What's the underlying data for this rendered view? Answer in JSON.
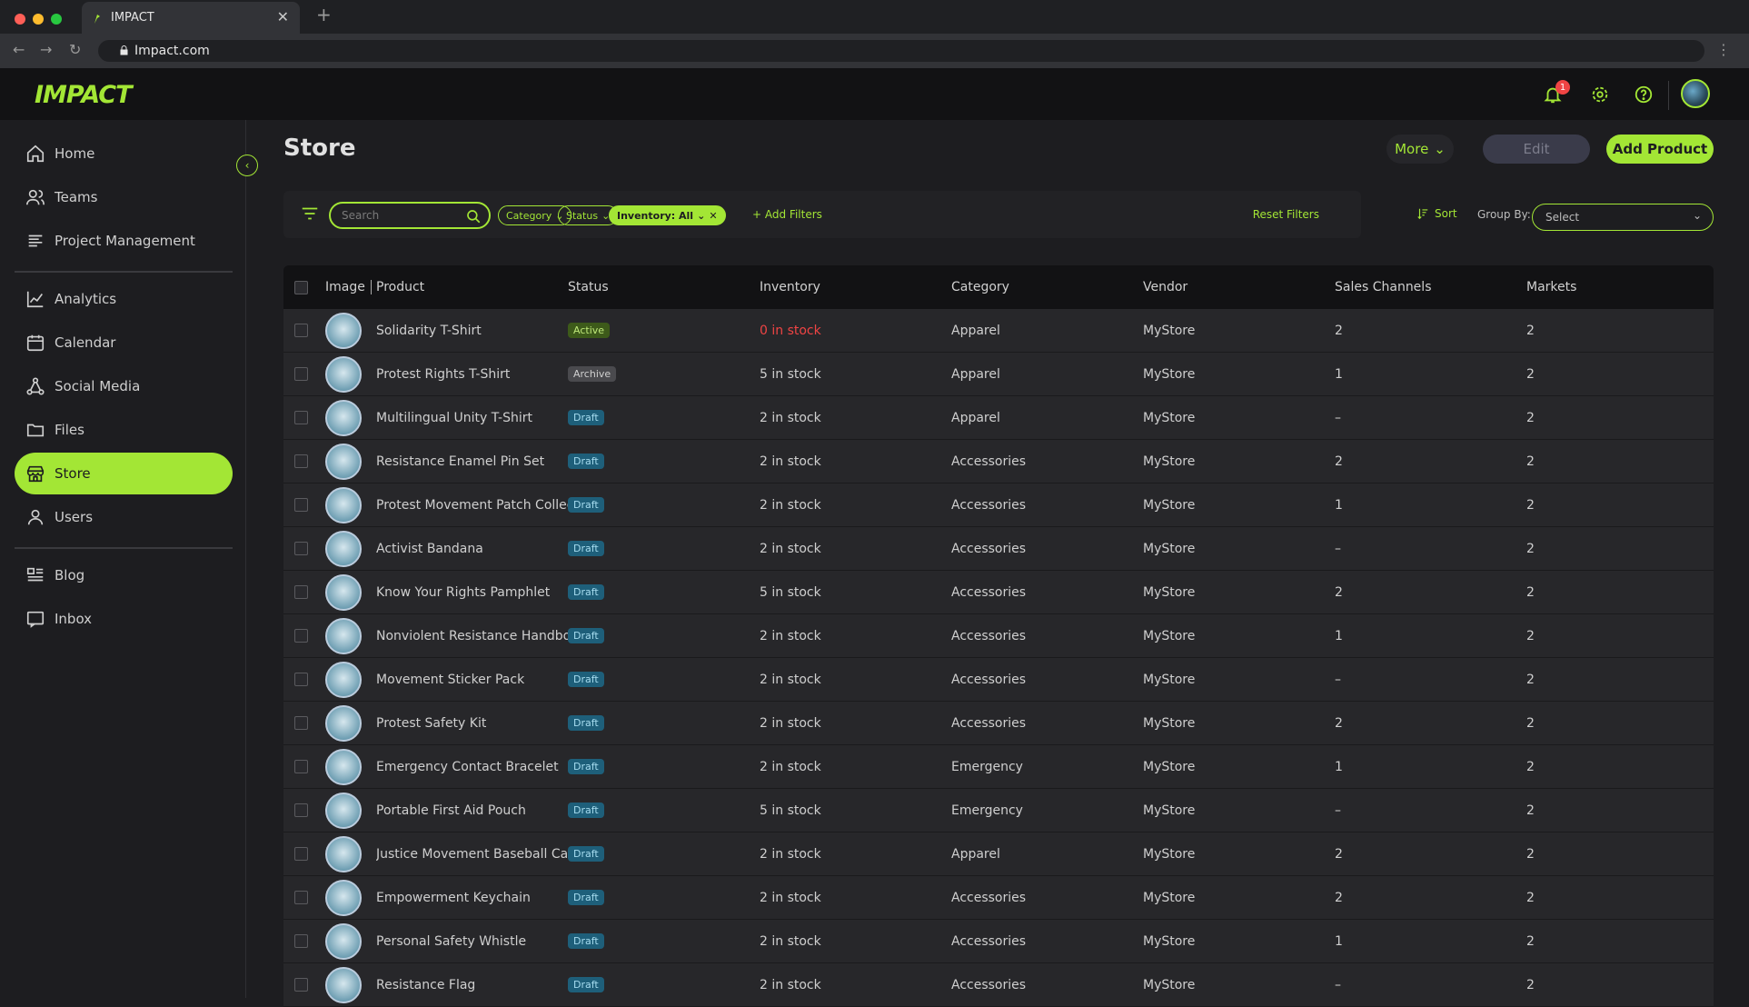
{
  "browser": {
    "tab_title": "IMPACT",
    "url": "Impact.com",
    "new_tab": "+",
    "close": "✕"
  },
  "header": {
    "logo": "IMPACT",
    "notification_count": "1"
  },
  "sidebar": {
    "items": [
      {
        "label": "Home",
        "icon": "home-icon"
      },
      {
        "label": "Teams",
        "icon": "users-icon"
      },
      {
        "label": "Project Management",
        "icon": "list-icon"
      },
      {
        "label": "Analytics",
        "icon": "chart-icon"
      },
      {
        "label": "Calendar",
        "icon": "calendar-icon"
      },
      {
        "label": "Social Media",
        "icon": "share-icon"
      },
      {
        "label": "Files",
        "icon": "folder-icon"
      },
      {
        "label": "Store",
        "icon": "store-icon"
      },
      {
        "label": "Users",
        "icon": "user-icon"
      },
      {
        "label": "Blog",
        "icon": "blog-icon"
      },
      {
        "label": "Inbox",
        "icon": "inbox-icon"
      }
    ]
  },
  "page": {
    "title": "Store",
    "more_label": "More",
    "edit_label": "Edit",
    "add_label": "Add Product"
  },
  "filters": {
    "search_placeholder": "Search",
    "category": "Category",
    "status": "Status",
    "inventory": "Inventory: All",
    "add_filters": "Add Filters",
    "reset_filters": "Reset Filters",
    "sort": "Sort",
    "group_by": "Group By:",
    "group_select": "Select"
  },
  "table": {
    "headers": [
      "Image",
      "Product",
      "Status",
      "Inventory",
      "Category",
      "Vendor",
      "Sales Channels",
      "Markets"
    ],
    "rows": [
      {
        "product": "Solidarity T-Shirt",
        "status": "Active",
        "inventory": "0 in stock",
        "category": "Apparel",
        "vendor": "MyStore",
        "sales": "2",
        "markets": "2"
      },
      {
        "product": "Protest Rights T-Shirt",
        "status": "Archive",
        "inventory": "5 in stock",
        "category": "Apparel",
        "vendor": "MyStore",
        "sales": "1",
        "markets": "2"
      },
      {
        "product": "Multilingual Unity T-Shirt",
        "status": "Draft",
        "inventory": "2 in stock",
        "category": "Apparel",
        "vendor": "MyStore",
        "sales": "–",
        "markets": "2"
      },
      {
        "product": "Resistance Enamel Pin Set",
        "status": "Draft",
        "inventory": "2 in stock",
        "category": "Accessories",
        "vendor": "MyStore",
        "sales": "2",
        "markets": "2"
      },
      {
        "product": "Protest Movement Patch Collect",
        "status": "Draft",
        "inventory": "2 in stock",
        "category": "Accessories",
        "vendor": "MyStore",
        "sales": "1",
        "markets": "2"
      },
      {
        "product": "Activist Bandana",
        "status": "Draft",
        "inventory": "2 in stock",
        "category": "Accessories",
        "vendor": "MyStore",
        "sales": "–",
        "markets": "2"
      },
      {
        "product": "Know Your Rights Pamphlet",
        "status": "Draft",
        "inventory": "5 in stock",
        "category": "Accessories",
        "vendor": "MyStore",
        "sales": "2",
        "markets": "2"
      },
      {
        "product": "Nonviolent Resistance Handbool",
        "status": "Draft",
        "inventory": "2 in stock",
        "category": "Accessories",
        "vendor": "MyStore",
        "sales": "1",
        "markets": "2"
      },
      {
        "product": "Movement Sticker Pack",
        "status": "Draft",
        "inventory": "2 in stock",
        "category": "Accessories",
        "vendor": "MyStore",
        "sales": "–",
        "markets": "2"
      },
      {
        "product": "Protest Safety Kit",
        "status": "Draft",
        "inventory": "2 in stock",
        "category": "Accessories",
        "vendor": "MyStore",
        "sales": "2",
        "markets": "2"
      },
      {
        "product": "Emergency Contact Bracelet",
        "status": "Draft",
        "inventory": "2 in stock",
        "category": "Emergency",
        "vendor": "MyStore",
        "sales": "1",
        "markets": "2"
      },
      {
        "product": "Portable First Aid Pouch",
        "status": "Draft",
        "inventory": "5 in stock",
        "category": "Emergency",
        "vendor": "MyStore",
        "sales": "–",
        "markets": "2"
      },
      {
        "product": "Justice Movement Baseball Cap",
        "status": "Draft",
        "inventory": "2 in stock",
        "category": "Apparel",
        "vendor": "MyStore",
        "sales": "2",
        "markets": "2"
      },
      {
        "product": "Empowerment Keychain",
        "status": "Draft",
        "inventory": "2 in stock",
        "category": "Accessories",
        "vendor": "MyStore",
        "sales": "2",
        "markets": "2"
      },
      {
        "product": "Personal Safety Whistle",
        "status": "Draft",
        "inventory": "2 in stock",
        "category": "Accessories",
        "vendor": "MyStore",
        "sales": "1",
        "markets": "2"
      },
      {
        "product": "Resistance Flag",
        "status": "Draft",
        "inventory": "2 in stock",
        "category": "Accessories",
        "vendor": "MyStore",
        "sales": "–",
        "markets": "2"
      }
    ]
  },
  "colors": {
    "accent": "#a3e635",
    "out_of_stock": "#ef4444",
    "draft": "#1e5f7a"
  }
}
